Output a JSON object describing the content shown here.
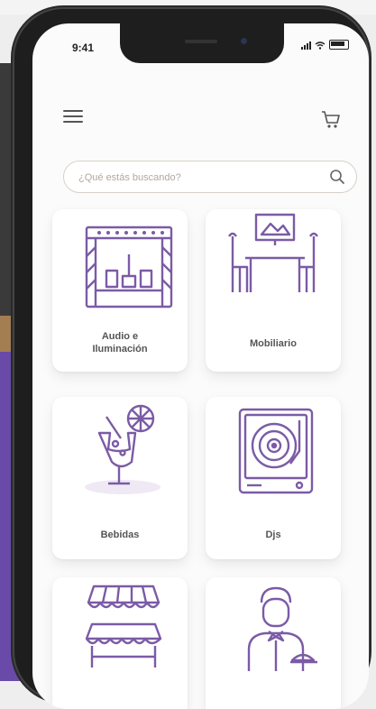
{
  "status": {
    "time": "9:41"
  },
  "search": {
    "placeholder": "¿Qué estás buscando?"
  },
  "categories": [
    {
      "label": "Audio e\nIluminación",
      "icon": "stage-icon"
    },
    {
      "label": "Mobiliario",
      "icon": "furniture-icon"
    },
    {
      "label": "Bebidas",
      "icon": "cocktail-icon"
    },
    {
      "label": "Djs",
      "icon": "turntable-icon"
    },
    {
      "label": "",
      "icon": "market-stall-icon"
    },
    {
      "label": "",
      "icon": "waiter-icon"
    }
  ],
  "colors": {
    "accent": "#7b5ba6",
    "text": "#555555"
  }
}
